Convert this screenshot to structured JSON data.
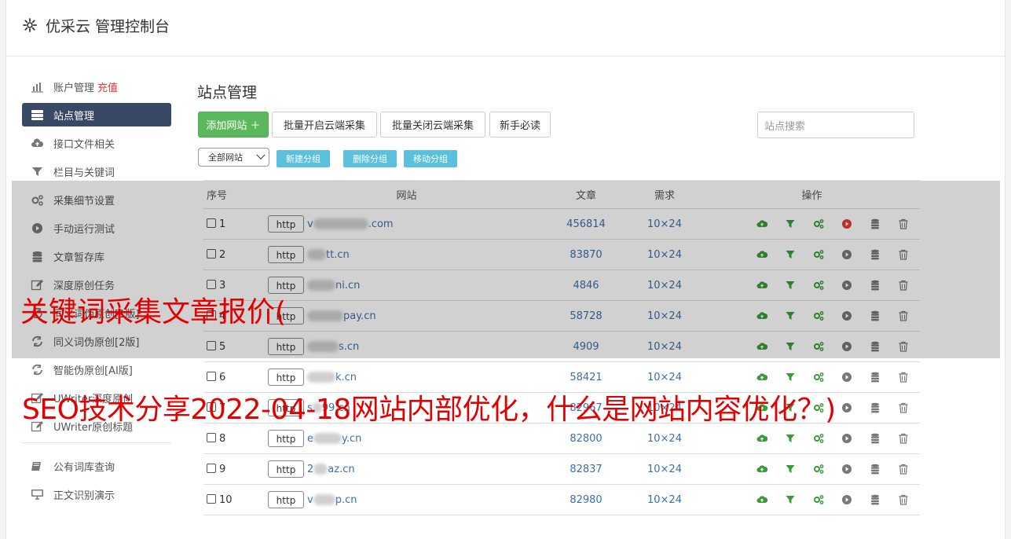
{
  "app": {
    "title": "优采云 管理控制台"
  },
  "sidebar": {
    "items": [
      {
        "label": "账户管理",
        "extra": "充值",
        "icon": "bar-chart-icon"
      },
      {
        "label": "站点管理",
        "icon": "server-icon",
        "active": true
      },
      {
        "label": "接口文件相关",
        "icon": "cloud-upload-icon"
      },
      {
        "label": "栏目与关键词",
        "icon": "filter-icon"
      },
      {
        "label": "采集细节设置",
        "icon": "gears-icon"
      },
      {
        "label": "手动运行测试",
        "icon": "play-circle-icon"
      },
      {
        "label": "文章暂存库",
        "icon": "database-icon"
      },
      {
        "label": "深度原创任务",
        "icon": "edit-icon"
      },
      {
        "label": "同义词伪原创[1版]",
        "icon": "refresh-icon"
      },
      {
        "label": "同义词伪原创[2版]",
        "icon": "refresh-icon"
      },
      {
        "label": "智能伪原创[AI版]",
        "icon": "refresh-icon"
      },
      {
        "label": "UWriter深度原创",
        "icon": "edit-icon"
      },
      {
        "label": "UWriter原创标题",
        "icon": "edit-icon"
      },
      {
        "label": "公有词库查询",
        "icon": "book-icon"
      },
      {
        "label": "正文识别演示",
        "icon": "monitor-icon"
      }
    ]
  },
  "main": {
    "heading": "站点管理",
    "buttons": {
      "add_site": "添加网站 ＋",
      "batch_open": "批量开启云端采集",
      "batch_close": "批量关闭云端采集",
      "newbie": "新手必读"
    },
    "search_placeholder": "站点搜索",
    "group_select": "全部网站",
    "group_buttons": {
      "new": "新建分组",
      "delete": "删除分组",
      "move": "移动分组"
    },
    "table": {
      "headers": [
        "序号",
        "网站",
        "文章",
        "需求",
        "操作"
      ],
      "http_label": "http",
      "rows": [
        {
          "n": "1",
          "site": ".com",
          "prefix": "v",
          "articles": "456814",
          "demand": "10×24"
        },
        {
          "n": "2",
          "site": "tt.cn",
          "prefix": "",
          "articles": "83870",
          "demand": "10×24"
        },
        {
          "n": "3",
          "site": "ni.cn",
          "prefix": "",
          "articles": "4846",
          "demand": "10×24"
        },
        {
          "n": "4",
          "site": "pay.cn",
          "prefix": "",
          "articles": "58728",
          "demand": "10×24"
        },
        {
          "n": "5",
          "site": "s.cn",
          "prefix": "",
          "articles": "4909",
          "demand": "10×24"
        },
        {
          "n": "6",
          "site": "k.cn",
          "prefix": "",
          "articles": "58421",
          "demand": "10×24"
        },
        {
          "n": "7",
          "site": "99.cn",
          "prefix": "s",
          "articles": "82967",
          "demand": "10×24"
        },
        {
          "n": "8",
          "site": "y.cn",
          "prefix": "e",
          "articles": "82800",
          "demand": "10×24"
        },
        {
          "n": "9",
          "site": "az.cn",
          "prefix": "2",
          "articles": "82837",
          "demand": "10×24"
        },
        {
          "n": "10",
          "site": "p.cn",
          "prefix": "v",
          "articles": "82980",
          "demand": "10×24"
        }
      ]
    }
  },
  "captions": {
    "line1": "关键词采集文章报价(",
    "line2": "SEO技术分享2022-04-18网站内部优化，什么是网站内容优化？)"
  },
  "colors": {
    "accent": "#384966",
    "green": "#5cb85c",
    "info": "#5bc0de",
    "link": "#3f6ea7",
    "caption": "#e30000"
  }
}
